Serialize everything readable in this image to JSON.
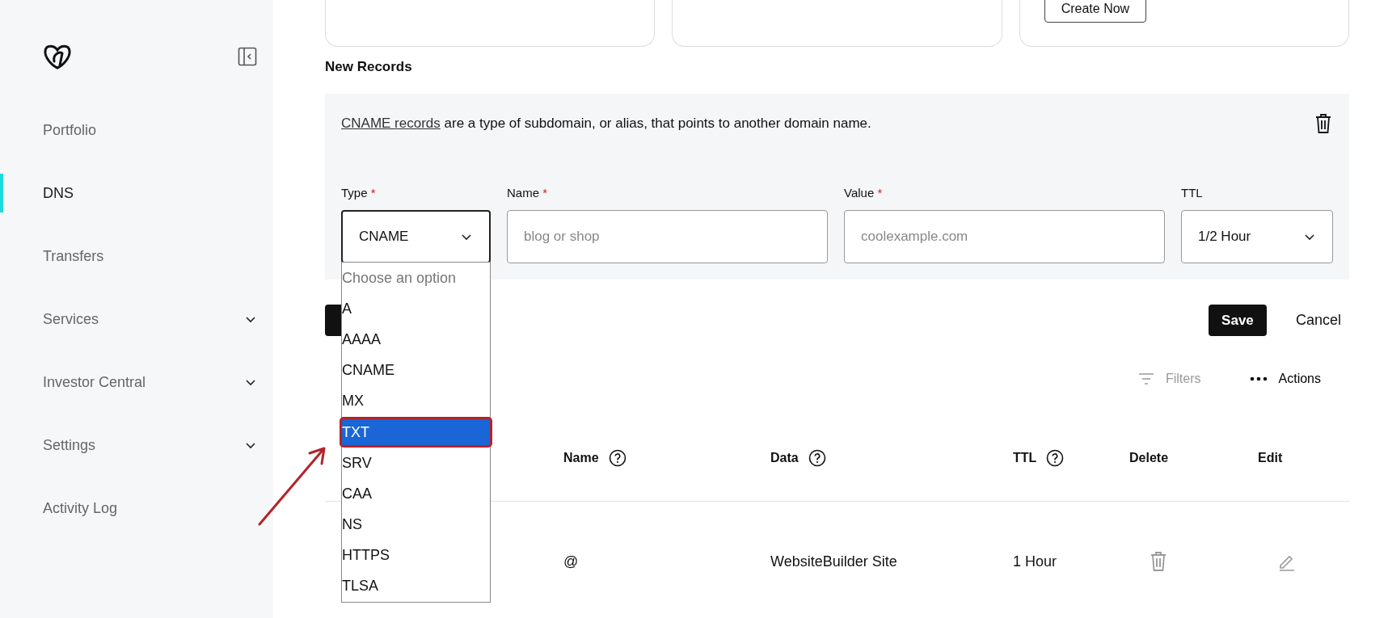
{
  "sidebar": {
    "items": [
      {
        "label": "Portfolio",
        "kind": "link",
        "selected": false
      },
      {
        "label": "DNS",
        "kind": "link",
        "selected": true
      },
      {
        "label": "Transfers",
        "kind": "link",
        "selected": false
      },
      {
        "label": "Services",
        "kind": "group",
        "selected": false
      },
      {
        "label": "Investor Central",
        "kind": "group",
        "selected": false
      },
      {
        "label": "Settings",
        "kind": "group",
        "selected": false
      },
      {
        "label": "Activity Log",
        "kind": "link",
        "selected": false
      }
    ]
  },
  "cards": [
    {
      "kind": "plain"
    },
    {
      "kind": "plain"
    },
    {
      "kind": "action",
      "button": "Create Now"
    }
  ],
  "new_records": {
    "title": "New Records",
    "description": {
      "link": "CNAME records",
      "text": " are a type of subdomain, or alias, that points to another domain name."
    },
    "fields": [
      {
        "kind": "select",
        "label": "Type",
        "mark": "*",
        "value": "CNAME",
        "focused": true
      },
      {
        "kind": "input",
        "label": "Name",
        "mark": "*",
        "placeholder": "blog or shop"
      },
      {
        "kind": "input",
        "label": "Value",
        "mark": "*",
        "placeholder": "coolexample.com"
      },
      {
        "kind": "select",
        "label": "TTL",
        "value": "1/2 Hour",
        "focused": false
      }
    ],
    "dropdown": {
      "placeholder": "Choose an option",
      "options": [
        {
          "label": "A",
          "selected": false
        },
        {
          "label": "AAAA",
          "selected": false
        },
        {
          "label": "CNAME",
          "selected": false
        },
        {
          "label": "MX",
          "selected": false
        },
        {
          "label": "TXT",
          "selected": true
        },
        {
          "label": "SRV",
          "selected": false
        },
        {
          "label": "CAA",
          "selected": false
        },
        {
          "label": "NS",
          "selected": false
        },
        {
          "label": "HTTPS",
          "selected": false
        },
        {
          "label": "TLSA",
          "selected": false
        }
      ]
    },
    "save": "Save",
    "cancel": "Cancel"
  },
  "toolbar": {
    "filters": "Filters",
    "actions": "Actions"
  },
  "table": {
    "columns": [
      {
        "label": "Name",
        "help": true
      },
      {
        "label": "Data",
        "help": true
      },
      {
        "label": "TTL",
        "help": true
      },
      {
        "label": "Delete",
        "help": false
      },
      {
        "label": "Edit",
        "help": false
      }
    ],
    "rows": [
      {
        "name": "@",
        "data": "WebsiteBuilder Site",
        "ttl": "1 Hour"
      }
    ]
  }
}
